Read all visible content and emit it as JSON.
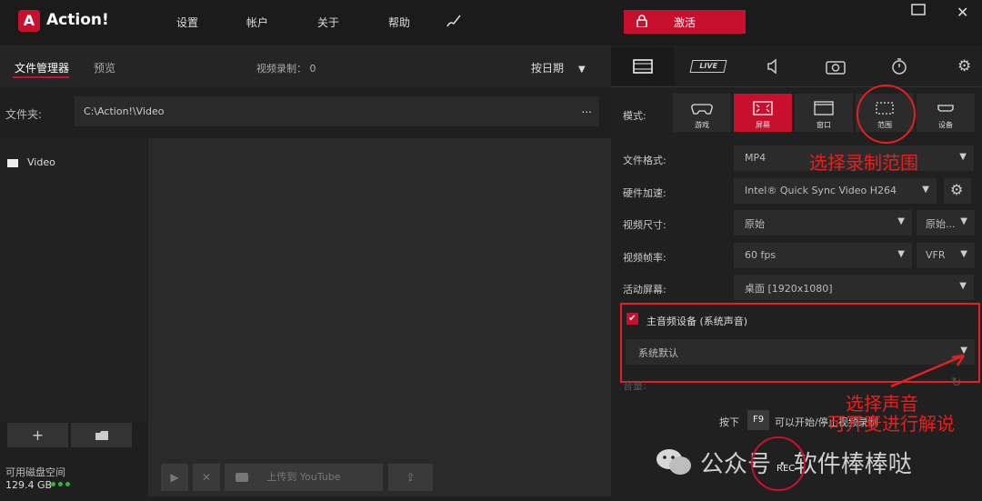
{
  "app": {
    "title": "Action!"
  },
  "menu": [
    "设置",
    "帐户",
    "关于",
    "帮助"
  ],
  "activate_label": "激活",
  "left": {
    "tabs": [
      "文件管理器",
      "预览"
    ],
    "recording_count": "视频录制： 0",
    "sort_label": "按日期",
    "folder_label": "文件夹:",
    "folder_path": "C:\\Action!\\Video",
    "folder_more": "...",
    "tree_items": [
      "Video"
    ],
    "disk_label": "可用磁盘空间",
    "disk_value": "129.4 GB",
    "upload_label": "上传到 YouTube"
  },
  "right": {
    "tabs": [
      "video-icon",
      "live-icon",
      "audio-icon",
      "camera-icon",
      "timer-icon",
      "gear-icon"
    ],
    "live_text": "LIVE",
    "mode_label": "模式:",
    "modes": [
      "游戏",
      "屏幕",
      "窗口",
      "范围",
      "设备"
    ],
    "rows": [
      {
        "label": "文件格式:",
        "value": "MP4"
      },
      {
        "label": "硬件加速:",
        "value": "Intel® Quick Sync Video H264"
      },
      {
        "label": "视频尺寸:",
        "value": "原始",
        "value2": "原始..."
      },
      {
        "label": "视频帧率:",
        "value": "60 fps",
        "value2": "VFR"
      },
      {
        "label": "活动屏幕:",
        "value": "桌面 [1920x1080]"
      }
    ],
    "audio_label": "主音频设备 (系统声音)",
    "audio_value": "系统默认",
    "volume_label": "音量:",
    "hint_press": "按下",
    "hint_key": "F9",
    "hint_text": "可以开始/停止视频录制",
    "rec_label": "REC"
  },
  "annotations": {
    "range": "选择录制范围",
    "voice": "选择声音",
    "narrate": "可开麦进行解说"
  },
  "watermark": "公众号 · 软件棒棒哒"
}
